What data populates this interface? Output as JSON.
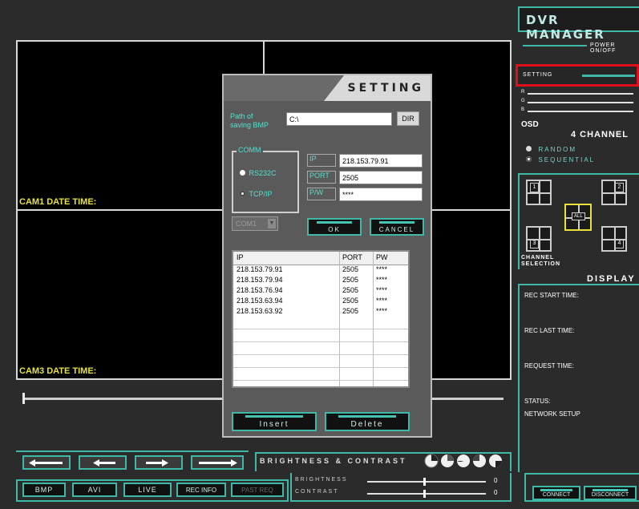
{
  "app": {
    "title": "DVR MANAGER"
  },
  "video": {
    "cam1_label": "CAM1 DATE TIME:",
    "cam3_label": "CAM3 DATE TIME:"
  },
  "right_panel": {
    "power_label": "POWER ON/OFF",
    "setting_label": "SETTING",
    "rgb": [
      "R",
      "G",
      "B"
    ],
    "osd_label": "OSD",
    "channel_count": "4 CHANNEL",
    "modes": [
      {
        "label": "RANDOM",
        "selected": false
      },
      {
        "label": "SEQUENTIAL",
        "selected": true
      }
    ],
    "grid": {
      "cells": [
        "1",
        "2",
        "3",
        "4"
      ],
      "all_label": "ALL"
    },
    "channel_selection_label": "CHANNEL SELECTION",
    "display_label": "DISPLAY",
    "info": {
      "rec_start": "REC START TIME:",
      "rec_last": "REC LAST TIME:",
      "request_time": "REQUEST TIME:",
      "status": "STATUS:",
      "network_setup": "NETWORK SETUP"
    },
    "connect_label": "CONNECT",
    "disconnect_label": "DISCONNECT"
  },
  "dialog": {
    "title": "SETTING",
    "path_label": "Path of saving BMP",
    "path_value": "C:\\",
    "dir_button": "DIR",
    "comm_label": "COMM",
    "comm_options": [
      {
        "label": "RS232C",
        "selected": false
      },
      {
        "label": "TCP/IP",
        "selected": true
      }
    ],
    "ip_label": "IP",
    "ip_value": "218.153.79.91",
    "port_label": "PORT",
    "port_value": "2505",
    "pw_label": "P/W",
    "pw_value": "****",
    "com_select": "COM1",
    "ok_button": "OK",
    "cancel_button": "CANCEL",
    "table_headers": [
      "IP",
      "PORT",
      "PW"
    ],
    "table_rows": [
      {
        "ip": "218.153.79.91",
        "port": "2505",
        "pw": "****"
      },
      {
        "ip": "218.153.79.94",
        "port": "2505",
        "pw": "****"
      },
      {
        "ip": "218.153.76.94",
        "port": "2505",
        "pw": "****"
      },
      {
        "ip": "218.153.63.94",
        "port": "2505",
        "pw": "****"
      },
      {
        "ip": "218.153.63.92",
        "port": "2505",
        "pw": "****"
      }
    ],
    "insert_button": "Insert",
    "delete_button": "Delete"
  },
  "bottom": {
    "bc_label": "BRIGHTNESS & CONTRAST",
    "brightness_label": "BRIGHTNESS",
    "contrast_label": "CONTRAST",
    "brightness_value": "0",
    "contrast_value": "0",
    "buttons": [
      "BMP",
      "AVI",
      "LIVE",
      "REC INFO",
      "PAST REQ"
    ]
  },
  "colors": {
    "accent": "#3fb8a8",
    "highlight": "#e8e23a",
    "setting_box": "#e0101a"
  }
}
